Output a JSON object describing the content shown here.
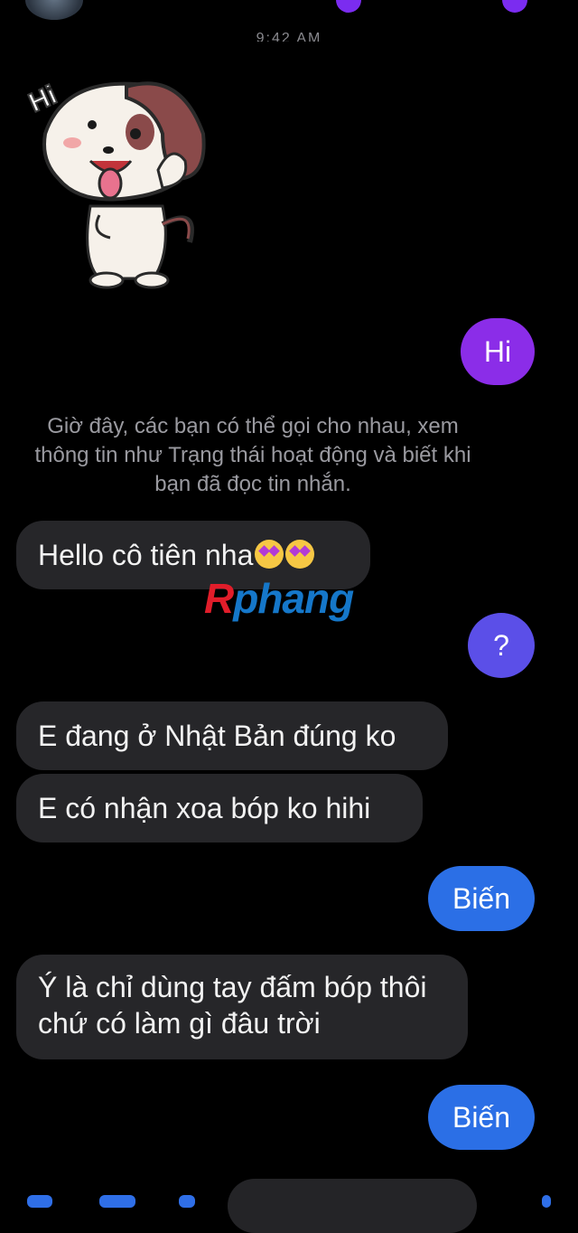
{
  "header": {
    "timestamp": "9:42 AM"
  },
  "sticker": {
    "label": "Hi"
  },
  "messages": [
    {
      "side": "out",
      "text": "Hi",
      "color": "#8b2de8"
    },
    {
      "side": "system",
      "text": "Giờ đây, các bạn có thể gọi cho nhau, xem thông tin như Trạng thái hoạt động và biết khi bạn đã đọc tin nhắn."
    },
    {
      "side": "in",
      "text": "Hello cô tiên nha"
    },
    {
      "side": "out",
      "text": "?",
      "color": "#5b4fe8"
    },
    {
      "side": "in",
      "text": "E đang ở Nhật Bản đúng ko"
    },
    {
      "side": "in",
      "text": "E có nhận xoa bóp ko hihi"
    },
    {
      "side": "out",
      "text": "Biến",
      "color": "#2b6fe6"
    },
    {
      "side": "in",
      "text": "Ý là chỉ dùng tay đấm bóp thôi chứ có làm gì đâu trời"
    },
    {
      "side": "out",
      "text": "Biến",
      "color": "#2b6fe6"
    }
  ],
  "watermark": {
    "r": "R",
    "rest": "phang"
  },
  "composer": {
    "icons": [
      "camera-icon",
      "image-icon",
      "mic-icon"
    ]
  }
}
